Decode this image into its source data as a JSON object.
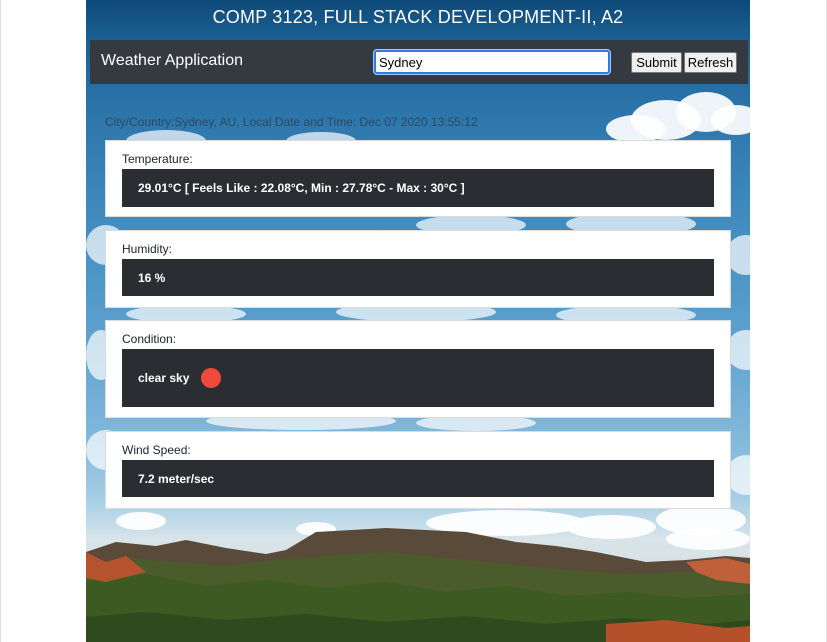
{
  "header": {
    "title": "COMP 3123, FULL STACK DEVELOPMENT-II, A2"
  },
  "navbar": {
    "brand": "Weather Application",
    "search_value": "Sydney",
    "submit_label": "Submit",
    "refresh_label": "Refresh"
  },
  "location": {
    "text": "City/Country:Sydney, AU, Local Date and Time: Dec 07 2020 13:55:12"
  },
  "cards": {
    "temperature": {
      "label": "Temperature:",
      "value": "29.01°C [ Feels Like : 22.08°C, Min : 27.78°C - Max : 30°C ]"
    },
    "humidity": {
      "label": "Humidity:",
      "value": "16 %"
    },
    "condition": {
      "label": "Condition:",
      "value": "clear sky",
      "icon": "sun-icon",
      "icon_color": "#f0493c"
    },
    "wind": {
      "label": "Wind Speed:",
      "value": "7.2 meter/sec"
    }
  },
  "colors": {
    "navbar_bg": "#343a40",
    "value_bg": "#2a2e33",
    "input_focus": "#2f7ae5"
  }
}
